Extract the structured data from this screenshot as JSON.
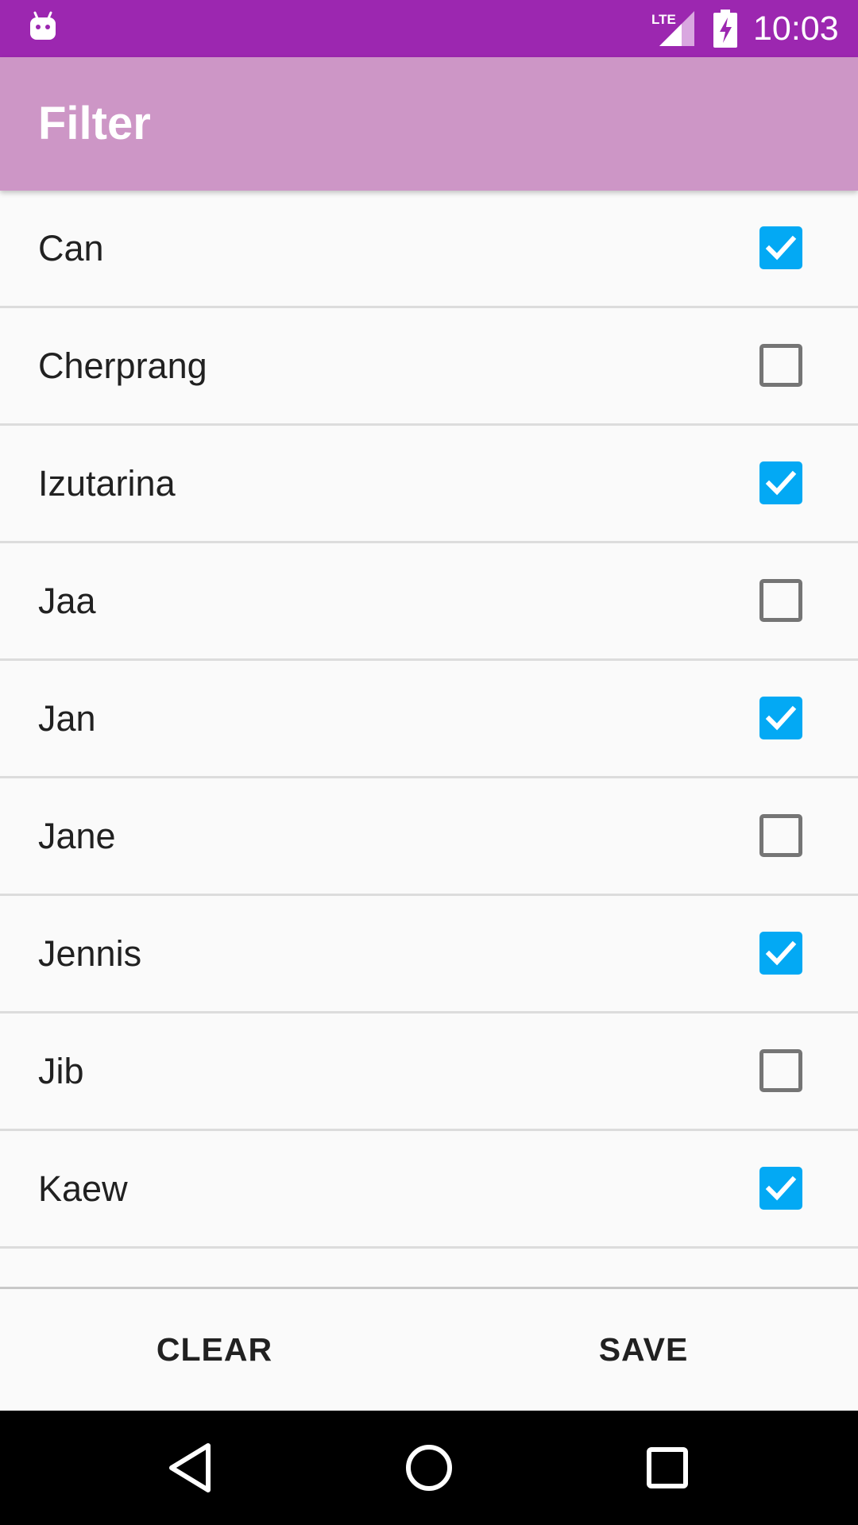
{
  "status_bar": {
    "time": "10:03",
    "icons": [
      "android-icon",
      "lte-signal-icon",
      "battery-charging-icon"
    ],
    "network_label": "LTE"
  },
  "app_bar": {
    "title": "Filter",
    "background_color": "#cd96c6"
  },
  "filter_list": {
    "items": [
      {
        "label": "Can",
        "checked": true
      },
      {
        "label": "Cherprang",
        "checked": false
      },
      {
        "label": "Izutarina",
        "checked": true
      },
      {
        "label": "Jaa",
        "checked": false
      },
      {
        "label": "Jan",
        "checked": true
      },
      {
        "label": "Jane",
        "checked": false
      },
      {
        "label": "Jennis",
        "checked": true
      },
      {
        "label": "Jib",
        "checked": false
      },
      {
        "label": "Kaew",
        "checked": true
      }
    ],
    "checked_color": "#03a9f4"
  },
  "actions": {
    "clear_label": "CLEAR",
    "save_label": "SAVE"
  },
  "nav_bar": {
    "icons": [
      "back-icon",
      "home-icon",
      "recents-icon"
    ]
  },
  "colors": {
    "status_bar": "#9c27b0",
    "accent": "#03a9f4"
  }
}
